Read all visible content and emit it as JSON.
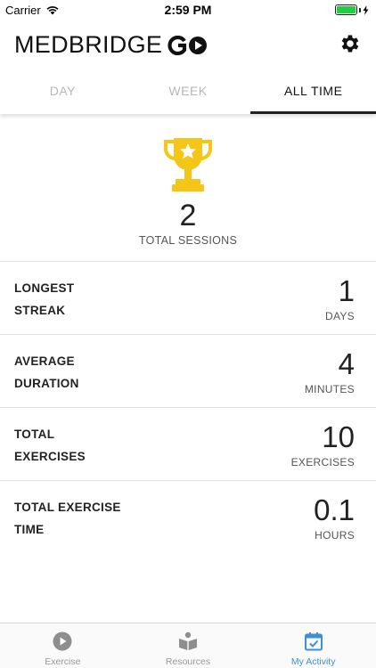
{
  "status_bar": {
    "carrier": "Carrier",
    "time": "2:59 PM",
    "battery_level": 1.0
  },
  "header": {
    "logo_text": "MEDBRIDGE",
    "logo_go": "GO",
    "settings_icon": "gear-icon"
  },
  "tabs": [
    {
      "label": "DAY",
      "active": false
    },
    {
      "label": "WEEK",
      "active": false
    },
    {
      "label": "ALL TIME",
      "active": true
    }
  ],
  "summary": {
    "icon": "trophy-icon",
    "value": "2",
    "label": "TOTAL SESSIONS"
  },
  "stats": [
    {
      "label_line1": "LONGEST",
      "label_line2": "STREAK",
      "value": "1",
      "unit": "DAYS"
    },
    {
      "label_line1": "AVERAGE",
      "label_line2": "DURATION",
      "value": "4",
      "unit": "MINUTES"
    },
    {
      "label_line1": "TOTAL",
      "label_line2": "EXERCISES",
      "value": "10",
      "unit": "EXERCISES"
    },
    {
      "label_line1": "TOTAL EXERCISE",
      "label_line2": "TIME",
      "value": "0.1",
      "unit": "HOURS"
    }
  ],
  "bottom_nav": [
    {
      "label": "Exercise",
      "icon": "play-circle-icon",
      "active": false
    },
    {
      "label": "Resources",
      "icon": "book-reader-icon",
      "active": false
    },
    {
      "label": "My Activity",
      "icon": "calendar-check-icon",
      "active": true
    }
  ],
  "colors": {
    "accent": "#3d8fd6",
    "trophy": "#f5c518",
    "battery": "#1fcf3b",
    "inactive_tab": "#b7b7b7"
  }
}
